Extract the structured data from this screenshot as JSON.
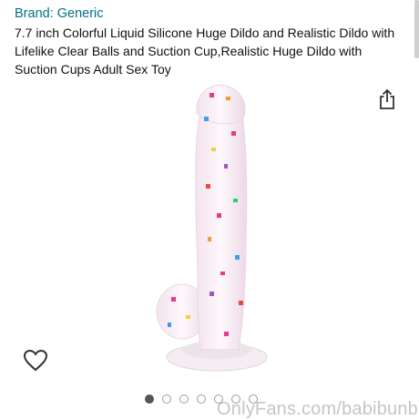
{
  "product": {
    "brand": "Brand: Generic",
    "title": "7.7 inch Colorful Liquid Silicone Huge Dildo and Realistic Dildo with Lifelike Clear Balls and Suction Cup,Realistic Huge Dildo with Suction Cups Adult Sex Toy"
  },
  "icons": {
    "share": "share-icon",
    "favorite": "heart-icon"
  },
  "carousel": {
    "total": 7,
    "active_index": 0
  },
  "watermark": "OnlyFans.com/babibunbun",
  "colors": {
    "link": "#007185",
    "text": "#0f1111",
    "dot_active": "#555555"
  }
}
